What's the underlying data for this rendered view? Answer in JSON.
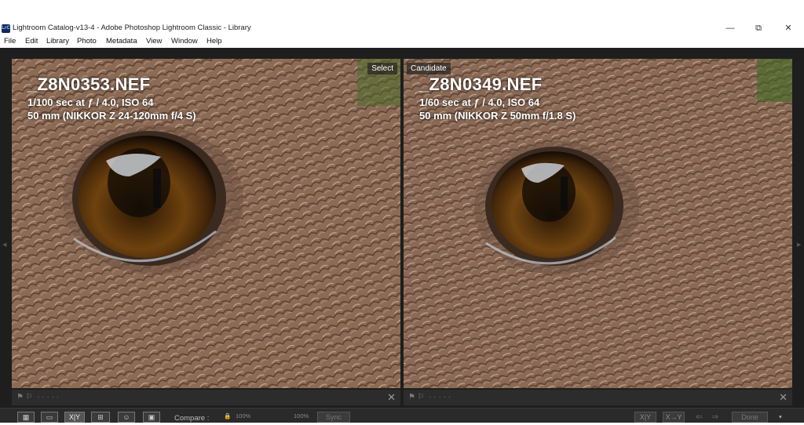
{
  "window": {
    "icon_text": "LrC",
    "title": "Lightroom Catalog-v13-4 - Adobe Photoshop Lightroom Classic - Library",
    "minimize": "—",
    "restore": "⧉",
    "close": "✕"
  },
  "menu": [
    "File",
    "Edit",
    "Library",
    "Photo",
    "Metadata",
    "View",
    "Window",
    "Help"
  ],
  "panes": {
    "select": {
      "label": "Select",
      "filename": "_Z8N0353.NEF",
      "exposure": "1/100 sec at ƒ / 4.0, ISO 64",
      "lens": "50 mm (NIKKOR Z 24-120mm f/4 S)"
    },
    "candidate": {
      "label": "Candidate",
      "filename": "_Z8N0349.NEF",
      "exposure": "1/60 sec at ƒ / 4.0, ISO 64",
      "lens": "50 mm (NIKKOR Z 50mm f/1.8 S)"
    }
  },
  "toolbar": {
    "compare_label": "Compare :",
    "zoom_left": "100%",
    "zoom_right": "100%",
    "sync_label": "Sync",
    "swap_label": "X|Y",
    "make_select_label": "X→Y",
    "done_label": "Done"
  },
  "colors": {
    "fur": "#8b6a55",
    "iris": "#6b3f0c",
    "background": "#1e1e1e"
  }
}
